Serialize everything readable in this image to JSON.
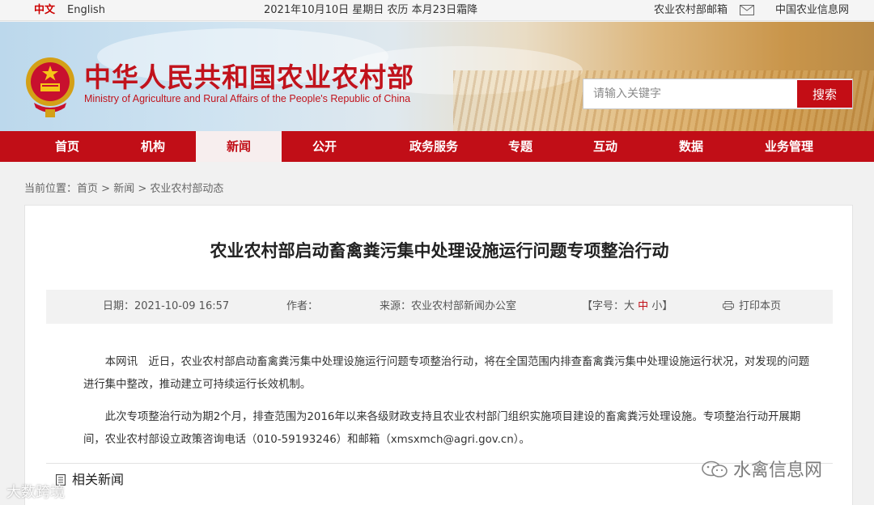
{
  "topbar": {
    "lang_zh": "中文",
    "lang_en": "English",
    "date": "2021年10月10日 星期日 农历 本月23日霜降",
    "mailbox": "农业农村部邮箱",
    "info_net": "中国农业信息网"
  },
  "header": {
    "title_cn": "中华人民共和国农业农村部",
    "title_en": "Ministry of Agriculture and Rural Affairs of the People's Republic of China",
    "search_placeholder": "请输入关键字",
    "search_button": "搜索"
  },
  "nav": {
    "items": [
      "首页",
      "机构",
      "新闻",
      "公开",
      "政务服务",
      "专题",
      "互动",
      "数据",
      "业务管理"
    ],
    "active": "新闻"
  },
  "breadcrumb": {
    "label": "当前位置：",
    "home": "首页",
    "sep1": " > ",
    "news": "新闻",
    "sep2": " > ",
    "current": "农业农村部动态"
  },
  "article": {
    "title": "农业农村部启动畜禽粪污集中处理设施运行问题专项整治行动",
    "date": "日期：2021-10-09 16:57",
    "author": "作者：",
    "source": "来源：农业农村部新闻办公室",
    "font_size_label": "【字号：",
    "size_large": "大",
    "size_mid": "中",
    "size_small": "小】",
    "print": "打印本页",
    "paragraphs": [
      "本网讯　近日，农业农村部启动畜禽粪污集中处理设施运行问题专项整治行动，将在全国范围内排查畜禽粪污集中处理设施运行状况，对发现的问题进行集中整改，推动建立可持续运行长效机制。",
      "此次专项整治行动为期2个月，排查范围为2016年以来各级财政支持且农业农村部门组织实施项目建设的畜禽粪污处理设施。专项整治行动开展期间，农业农村部设立政策咨询电话（010-59193246）和邮箱（xmsxmch@agri.gov.cn）。"
    ],
    "related": "相关新闻"
  },
  "watermarks": {
    "right": "水禽信息网",
    "left": "大数跨境"
  },
  "colors": {
    "brand_red": "#c10e17",
    "nav_active_bg": "#f7eeee"
  }
}
